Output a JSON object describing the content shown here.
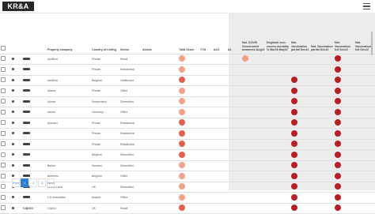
{
  "app": {
    "logo": "KR&A"
  },
  "columns": {
    "company": "Property company",
    "country": "Country of Listing",
    "sector": "Sector",
    "assets": "Assets",
    "total": "Total Score",
    "ytd": "YTD",
    "c1": "Δ/12",
    "c2": "Δ1",
    "m1": "Nat. COVID Government measures Aug22",
    "m2": "Regional cum. excess mortality % Mar20-May22",
    "m3": "Nat. Vaccination partial Dec22",
    "m4": "Nat. Vaccination partial Dec22",
    "m5": "Nat. Vaccination full Dec22",
    "m6": "Nat. Vaccination full Dec22"
  },
  "rows": [
    {
      "logo_text": "",
      "company": "Aedifica",
      "country": "Private",
      "sector": "Retail",
      "assets": "",
      "total": "",
      "ytd": "",
      "c1": "",
      "c2": "",
      "m1": "",
      "m2": "",
      "m3": "",
      "m4": "",
      "m5": "",
      "m6": ""
    },
    {
      "logo_text": "",
      "company": "",
      "country": "Private",
      "sector": "Residential",
      "assets": "",
      "total": "",
      "ytd": "",
      "c1": "",
      "c2": "",
      "m1": "",
      "m2": "",
      "m3": "",
      "m4": "",
      "m5": "",
      "m6": ""
    },
    {
      "logo_text": "",
      "company": "Aedifica",
      "country": "Belgium",
      "sector": "Healthcare",
      "assets": "",
      "total": "",
      "ytd": "",
      "c1": "",
      "c2": "",
      "m1": "",
      "m2": "",
      "m3": "",
      "m4": "",
      "m5": "",
      "m6": ""
    },
    {
      "logo_text": "",
      "company": "Alfana",
      "country": "Private",
      "sector": "Office",
      "assets": "",
      "total": "",
      "ytd": "",
      "c1": "",
      "c2": "",
      "m1": "",
      "m2": "",
      "m3": "",
      "m4": "",
      "m5": "",
      "m6": ""
    },
    {
      "logo_text": "",
      "company": "Allreal",
      "country": "Switzerland",
      "sector": "Diversified",
      "assets": "",
      "total": "",
      "ytd": "",
      "c1": "",
      "c2": "",
      "m1": "",
      "m2": "",
      "m3": "",
      "m4": "",
      "m5": "",
      "m6": ""
    },
    {
      "logo_text": "",
      "company": "alstria",
      "country": "Germany",
      "sector": "Office",
      "assets": "",
      "total": "",
      "ytd": "",
      "c1": "",
      "c2": "",
      "m1": "",
      "m2": "",
      "m3": "",
      "m4": "",
      "m5": "",
      "m6": ""
    },
    {
      "logo_text": "",
      "company": "Annaert",
      "country": "Private",
      "sector": "Residential",
      "assets": "",
      "total": "",
      "ytd": "",
      "c1": "",
      "c2": "",
      "m1": "",
      "m2": "",
      "m3": "",
      "m4": "",
      "m5": "",
      "m6": ""
    },
    {
      "logo_text": "",
      "company": "",
      "country": "Private",
      "sector": "Residential",
      "assets": "",
      "total": "",
      "ytd": "",
      "c1": "",
      "c2": "",
      "m1": "",
      "m2": "",
      "m3": "",
      "m4": "",
      "m5": "",
      "m6": ""
    },
    {
      "logo_text": "",
      "company": "",
      "country": "Private",
      "sector": "Residential",
      "assets": "",
      "total": "",
      "ytd": "",
      "c1": "",
      "c2": "",
      "m1": "",
      "m2": "",
      "m3": "",
      "m4": "",
      "m5": "",
      "m6": ""
    },
    {
      "logo_text": "",
      "company": "",
      "country": "Belgium",
      "sector": "Diversified",
      "assets": "",
      "total": "",
      "ytd": "",
      "c1": "",
      "c2": "",
      "m1": "",
      "m2": "",
      "m3": "",
      "m4": "",
      "m5": "",
      "m6": ""
    },
    {
      "logo_text": "",
      "company": "Balder",
      "country": "Sweden",
      "sector": "Diversified",
      "assets": "",
      "total": "",
      "ytd": "",
      "c1": "",
      "c2": "",
      "m1": "",
      "m2": "",
      "m3": "",
      "m4": "",
      "m5": "",
      "m6": ""
    },
    {
      "logo_text": "",
      "company": "Befimmo",
      "country": "Belgium",
      "sector": "Office",
      "assets": "",
      "total": "",
      "ytd": "",
      "c1": "",
      "c2": "",
      "m1": "",
      "m2": "",
      "m3": "",
      "m4": "",
      "m5": "",
      "m6": ""
    },
    {
      "logo_text": "",
      "company": "British Land",
      "country": "UK",
      "sector": "Diversified",
      "assets": "",
      "total": "",
      "ytd": "",
      "c1": "",
      "c2": "",
      "m1": "",
      "m2": "",
      "m3": "",
      "m4": "",
      "m5": "",
      "m6": ""
    },
    {
      "logo_text": "",
      "company": "CA Immobilien",
      "country": "Austria",
      "sector": "Office",
      "assets": "",
      "total": "",
      "ytd": "",
      "c1": "",
      "c2": "",
      "m1": "",
      "m2": "",
      "m3": "",
      "m4": "",
      "m5": "",
      "m6": ""
    },
    {
      "logo_text": "capco",
      "company": "CapCo",
      "country": "UK",
      "sector": "Retail",
      "assets": "",
      "total": "",
      "ytd": "",
      "c1": "",
      "c2": "",
      "m1": "",
      "m2": "",
      "m3": "",
      "m4": "",
      "m5": "",
      "m6": ""
    }
  ],
  "badges": {
    "total": [
      "lt",
      "lt",
      "md",
      "lt",
      "lt",
      "lt",
      "md",
      "md",
      "md",
      "md",
      "lt",
      "lt",
      "lt",
      "lt",
      "md"
    ],
    "m3": [
      "",
      "",
      "dk",
      "dk",
      "dk",
      "dk",
      "dk",
      "dk",
      "dk",
      "dk",
      "dk",
      "dk",
      "dk",
      "dk",
      "dk"
    ],
    "m5": [
      "dk",
      "dk",
      "dk",
      "dk",
      "dk",
      "dk",
      "dk",
      "dk",
      "dk",
      "dk",
      "dk",
      "dk",
      "dk",
      "dk",
      "dk"
    ],
    "m1": [
      "lt",
      "",
      "",
      "",
      "",
      "",
      "",
      "",
      "",
      "",
      "",
      "",
      "",
      "",
      ""
    ]
  },
  "pager": {
    "pages": [
      "Prev",
      "1",
      "2",
      "3",
      "Next"
    ],
    "active": "1"
  },
  "colors": {
    "badge_light": "#f1a08a",
    "badge_mid": "#e2604d",
    "badge_dark": "#b51f25",
    "pager_blue": "#2e7fd1"
  }
}
